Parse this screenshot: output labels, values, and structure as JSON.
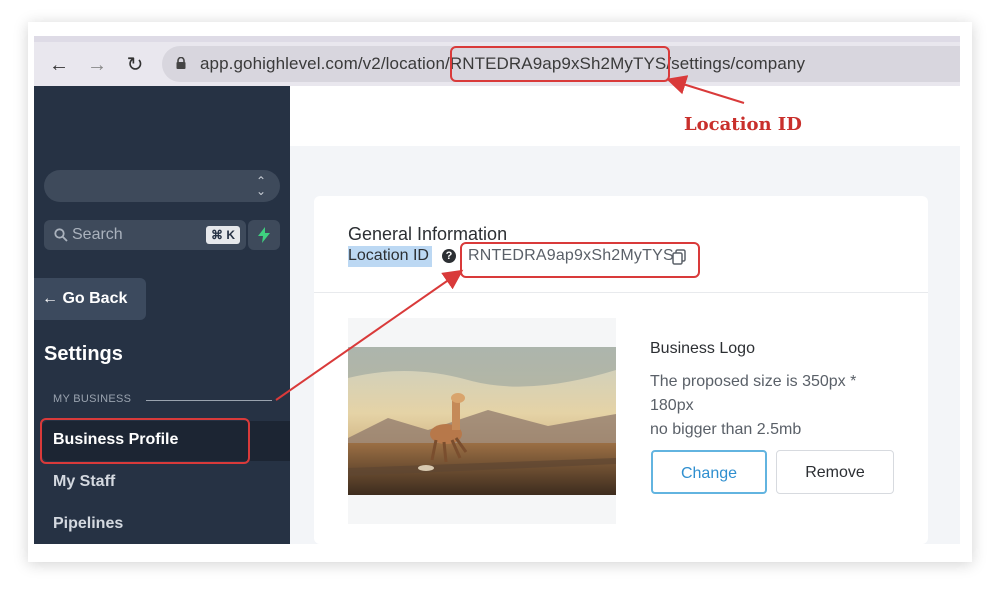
{
  "browser": {
    "url_prefix": "app.gohighlevel.com/v2/location/",
    "url_location_id": "RNTEDRA9ap9xSh2MyTYS",
    "url_suffix": "/settings/company"
  },
  "annotation": {
    "label": "Location ID",
    "color": "#d93a3a"
  },
  "sidebar": {
    "search_placeholder": "Search",
    "search_shortcut": "⌘ K",
    "go_back_label": "Go Back",
    "settings_title": "Settings",
    "section_label": "MY BUSINESS",
    "items": [
      {
        "label": "Business Profile",
        "active": true
      },
      {
        "label": "My Staff",
        "active": false
      },
      {
        "label": "Pipelines",
        "active": false
      }
    ]
  },
  "main": {
    "card_title": "General Information",
    "location_label": "Location ID",
    "location_id": "RNTEDRA9ap9xSh2MyTYS",
    "business_logo": {
      "title": "Business Logo",
      "desc_line1": "The proposed size is 350px *",
      "desc_line2": "180px",
      "desc_line3": "no bigger than 2.5mb",
      "change_label": "Change",
      "remove_label": "Remove"
    }
  },
  "colors": {
    "sidebar_bg": "#263244",
    "accent": "#2f8fcf",
    "annotation_red": "#d93a3a"
  }
}
